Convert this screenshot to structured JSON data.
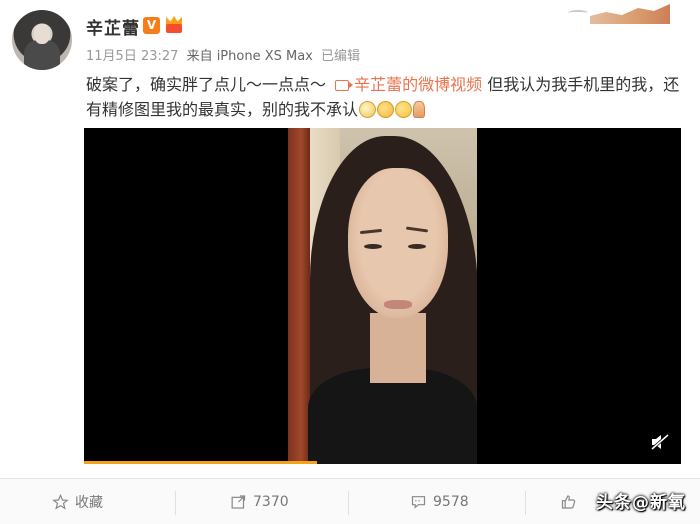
{
  "post": {
    "username": "辛芷蕾",
    "verified_badge": "V",
    "timestamp": "11月5日 23:27",
    "source": "来自 iPhone XS Max",
    "edited_label": "已编辑",
    "text_part1": "破案了，确实胖了点儿～一点点～",
    "video_link_label": "辛芷蕾的微博视频",
    "text_part2": " 但我认为我手机里的我，还有精修图里我的最真实，别的我不承认",
    "emojis": [
      "doge-face",
      "laugh-cry-face",
      "grin-face",
      "thumbs-up"
    ],
    "icons": {
      "vip": "vip-crown-icon",
      "video_link": "video-icon",
      "mute": "mute-icon",
      "favorite": "star-icon",
      "repost": "repost-icon",
      "comment": "comment-icon",
      "like": "thumbs-up-icon"
    }
  },
  "video": {
    "progress": 0.39
  },
  "toolbar": {
    "favorite_label": "收藏",
    "repost_count": "7370",
    "comment_count": "9578"
  },
  "watermark": "头条@新氧",
  "colors": {
    "link": "#eb7350",
    "progress": "#f4a21c",
    "badge": "#f57e1b",
    "meta_text": "#999999"
  }
}
